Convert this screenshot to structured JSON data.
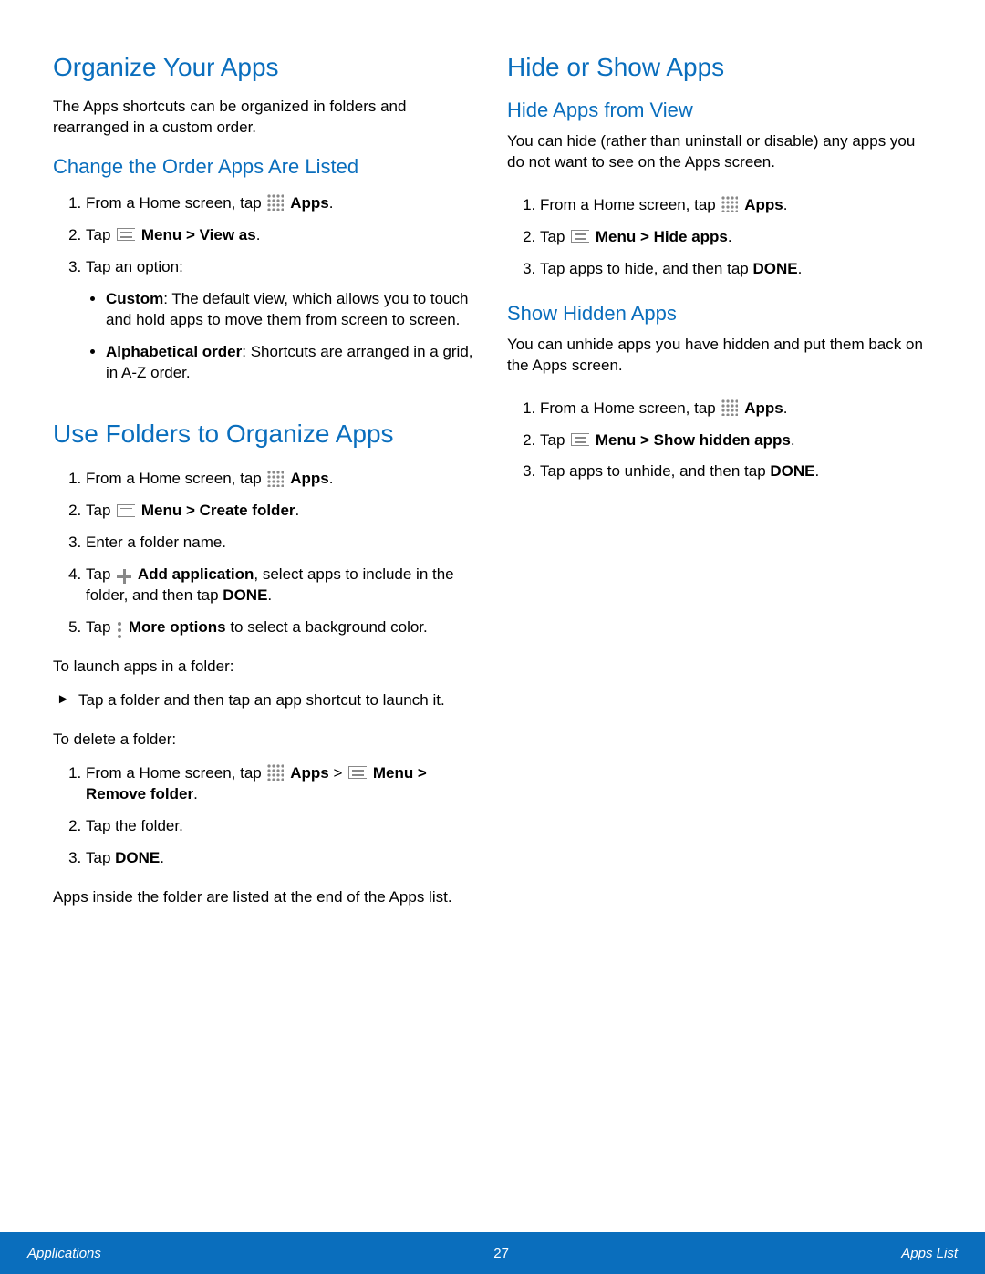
{
  "left": {
    "h1_organize": "Organize Your Apps",
    "intro": "The Apps shortcuts can be organized in folders and rearranged in a custom order.",
    "h2_change": "Change the Order Apps Are Listed",
    "change_steps": {
      "s1a": "From a Home screen, tap",
      "s1b": "Apps",
      "s2a": "Tap",
      "s2b": "Menu > View as",
      "s3": "Tap an option:",
      "opt1_label": "Custom",
      "opt1_text": ": The default view, which allows you to touch and hold apps to move them from screen to screen.",
      "opt2_label": "Alphabetical order",
      "opt2_text": ": Shortcuts are arranged in a grid, in A-Z order."
    },
    "h1_folders": "Use Folders to Organize Apps",
    "folder_steps": {
      "s1a": "From a Home screen, tap",
      "s1b": "Apps",
      "s2a": "Tap",
      "s2b": "Menu > Create folder",
      "s3": "Enter a folder name.",
      "s4a": "Tap",
      "s4b": "Add application",
      "s4c": ", select apps to include in the folder, and then tap ",
      "s4d": "DONE",
      "s5a": "Tap",
      "s5b": "More options",
      "s5c": " to select a background color."
    },
    "launch_label": "To launch apps in a folder:",
    "launch_item": "Tap a folder and then tap an app shortcut to launch it.",
    "delete_label": "To delete a folder:",
    "del_steps": {
      "s1a": "From a Home screen, tap",
      "s1b": "Apps",
      "s1c": " > ",
      "s1d": "Menu > Remove folder",
      "s2": "Tap the folder.",
      "s3a": "Tap ",
      "s3b": "DONE"
    },
    "folder_note": "Apps inside the folder are listed at the end of the Apps list."
  },
  "right": {
    "h1_hide": "Hide or Show Apps",
    "h2_hidefrom": "Hide Apps from View",
    "hide_intro": "You can hide (rather than uninstall or disable) any apps you do not want to see on the Apps screen.",
    "hide_steps": {
      "s1a": "From a Home screen, tap",
      "s1b": "Apps",
      "s2a": "Tap",
      "s2b": "Menu > Hide apps",
      "s3a": "Tap apps to hide, and then tap ",
      "s3b": "DONE"
    },
    "h2_show": "Show Hidden Apps",
    "show_intro": "You can unhide apps you have hidden and put them back on the Apps screen.",
    "show_steps": {
      "s1a": "From a Home screen, tap",
      "s1b": "Apps",
      "s2a": "Tap",
      "s2b": "Menu > Show hidden apps",
      "s3a": "Tap apps to unhide, and then tap ",
      "s3b": "DONE"
    }
  },
  "footer": {
    "left": "Applications",
    "center": "27",
    "right": "Apps List"
  }
}
